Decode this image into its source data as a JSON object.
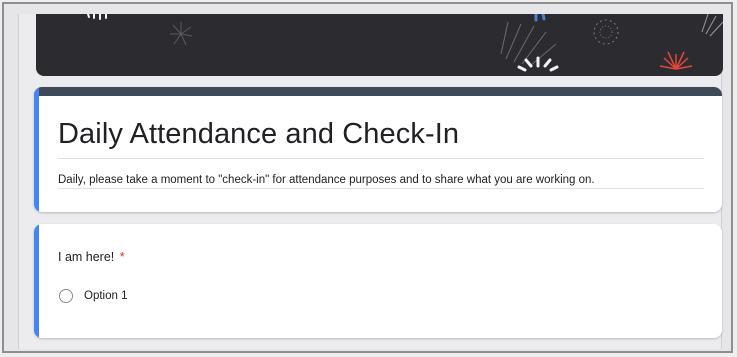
{
  "form": {
    "title": "Daily Attendance and Check-In",
    "description": "Daily, please take a moment to \"check-in\" for attendance purposes and to share what you are working on."
  },
  "question": {
    "label": "I am here!",
    "required_marker": "*",
    "options": [
      {
        "label": "Option 1",
        "selected": false
      }
    ]
  },
  "colors": {
    "accent": "#4285f4",
    "header_bar": "#3f4a58",
    "banner": "#2b2b30",
    "required": "#d93025"
  }
}
